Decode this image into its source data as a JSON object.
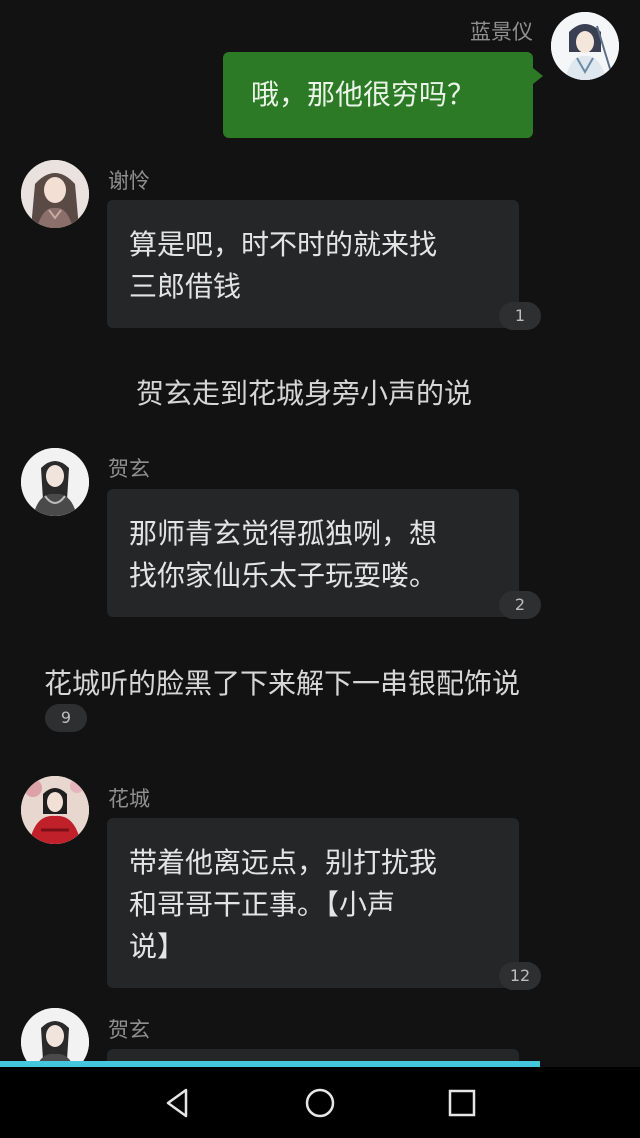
{
  "messages": [
    {
      "sender": "蓝景仪",
      "text": "哦，那他很穷吗？"
    },
    {
      "sender": "谢怜",
      "line1": "算是吧，时不时的就来找",
      "line2": "三郎借钱",
      "count": "1"
    },
    {
      "narration": "贺玄走到花城身旁小声的说"
    },
    {
      "sender": "贺玄",
      "line1": "那师青玄觉得孤独咧，想",
      "line2": "找你家仙乐太子玩耍喽。",
      "count": "2"
    },
    {
      "narration": "花城听的脸黑了下来解下一串银配饰说",
      "count": "9"
    },
    {
      "sender": "花城",
      "line1": "带着他离远点，别打扰我",
      "line2": "和哥哥干正事。【小声",
      "line3": "说】",
      "count": "12"
    },
    {
      "sender": "贺玄"
    }
  ],
  "nav": {
    "back": "back-triangle-icon",
    "home": "home-circle-icon",
    "recents": "recents-square-icon"
  },
  "colors": {
    "background": "#121212",
    "bubble_in": "#252628",
    "bubble_out": "#2c7a26",
    "progress": "#46c6dd"
  }
}
